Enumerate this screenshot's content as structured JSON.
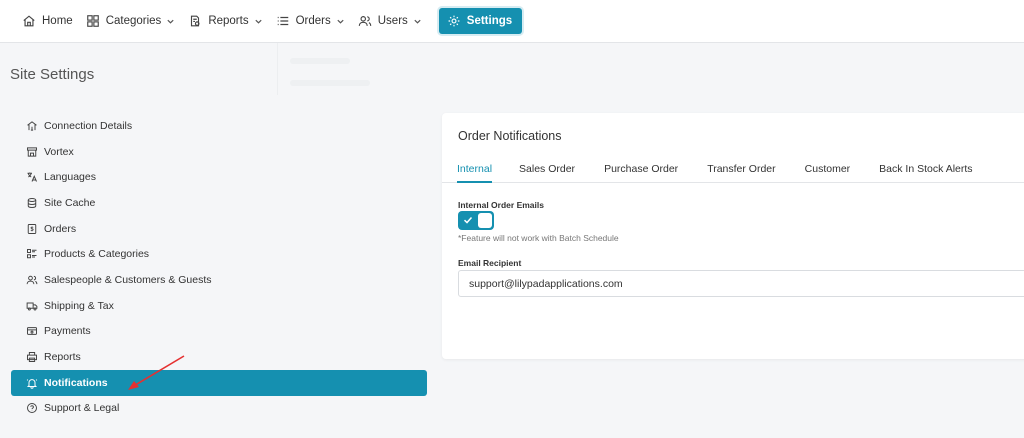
{
  "nav": {
    "items": [
      {
        "label": "Home",
        "icon": "home-icon",
        "has_dropdown": false
      },
      {
        "label": "Categories",
        "icon": "grid-icon",
        "has_dropdown": true
      },
      {
        "label": "Reports",
        "icon": "report-icon",
        "has_dropdown": true
      },
      {
        "label": "Orders",
        "icon": "list-icon",
        "has_dropdown": true
      },
      {
        "label": "Users",
        "icon": "users-icon",
        "has_dropdown": true
      }
    ],
    "settings_label": "Settings"
  },
  "sidebar": {
    "title": "Site Settings",
    "items": [
      {
        "label": "Connection Details",
        "icon": "connection-icon"
      },
      {
        "label": "Vortex",
        "icon": "store-icon"
      },
      {
        "label": "Languages",
        "icon": "translate-icon"
      },
      {
        "label": "Site Cache",
        "icon": "database-icon"
      },
      {
        "label": "Orders",
        "icon": "dollar-doc-icon"
      },
      {
        "label": "Products & Categories",
        "icon": "product-list-icon"
      },
      {
        "label": "Salespeople & Customers & Guests",
        "icon": "users-icon"
      },
      {
        "label": "Shipping & Tax",
        "icon": "truck-icon"
      },
      {
        "label": "Payments",
        "icon": "payment-icon"
      },
      {
        "label": "Reports",
        "icon": "printer-icon"
      },
      {
        "label": "Notifications",
        "icon": "bell-icon",
        "active": true
      },
      {
        "label": "Support & Legal",
        "icon": "help-icon"
      }
    ]
  },
  "card": {
    "title": "Order Notifications",
    "tabs": [
      "Internal",
      "Sales Order",
      "Purchase Order",
      "Transfer Order",
      "Customer",
      "Back In Stock Alerts"
    ],
    "active_tab": "Internal",
    "internal_emails_label": "Internal Order Emails",
    "internal_emails_enabled": true,
    "hint": "*Feature will not work with Batch Schedule",
    "email_label": "Email Recipient",
    "email_value": "support@lilypadapplications.com"
  },
  "colors": {
    "accent": "#1590b0",
    "annotation_arrow": "#e53030"
  }
}
